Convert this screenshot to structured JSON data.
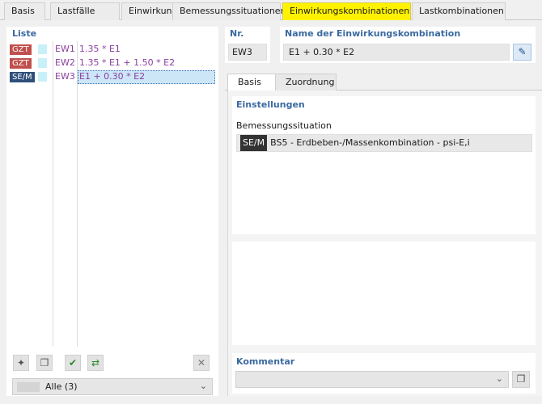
{
  "tabs": [
    "Basis",
    "Lastfälle",
    "Einwirkungen",
    "Bemessungssituationen",
    "Einwirkungskombinationen",
    "Lastkombinationen"
  ],
  "list": {
    "title": "Liste",
    "rows": [
      {
        "badge": "GZT",
        "badge_color": "#c0504d",
        "id": "EW1",
        "expr": "1.35 * E1"
      },
      {
        "badge": "GZT",
        "badge_color": "#c0504d",
        "id": "EW2",
        "expr": "1.35 * E1 + 1.50 * E2"
      },
      {
        "badge": "SE/M",
        "badge_color": "#2f4f7a",
        "id": "EW3",
        "expr": "E1 + 0.30 * E2"
      }
    ],
    "filter_label": "Alle (3)"
  },
  "nr": {
    "label": "Nr.",
    "value": "EW3"
  },
  "name": {
    "label": "Name der Einwirkungskombination",
    "value": "E1 + 0.30 * E2"
  },
  "subtabs": [
    "Basis",
    "Zuordnung"
  ],
  "settings": {
    "title": "Einstellungen",
    "field_label": "Bemessungssituation",
    "tag": "SE/M",
    "value": "BS5 - Erdbeben-/Massenkombination - psi-E,i"
  },
  "comment": {
    "title": "Kommentar",
    "value": ""
  },
  "icons": [
    "new-icon",
    "copy-icon",
    "check-all-icon",
    "check-toggle-icon",
    "delete-icon",
    "edit-icon",
    "comment-library-icon",
    "chevron-down-icon"
  ]
}
